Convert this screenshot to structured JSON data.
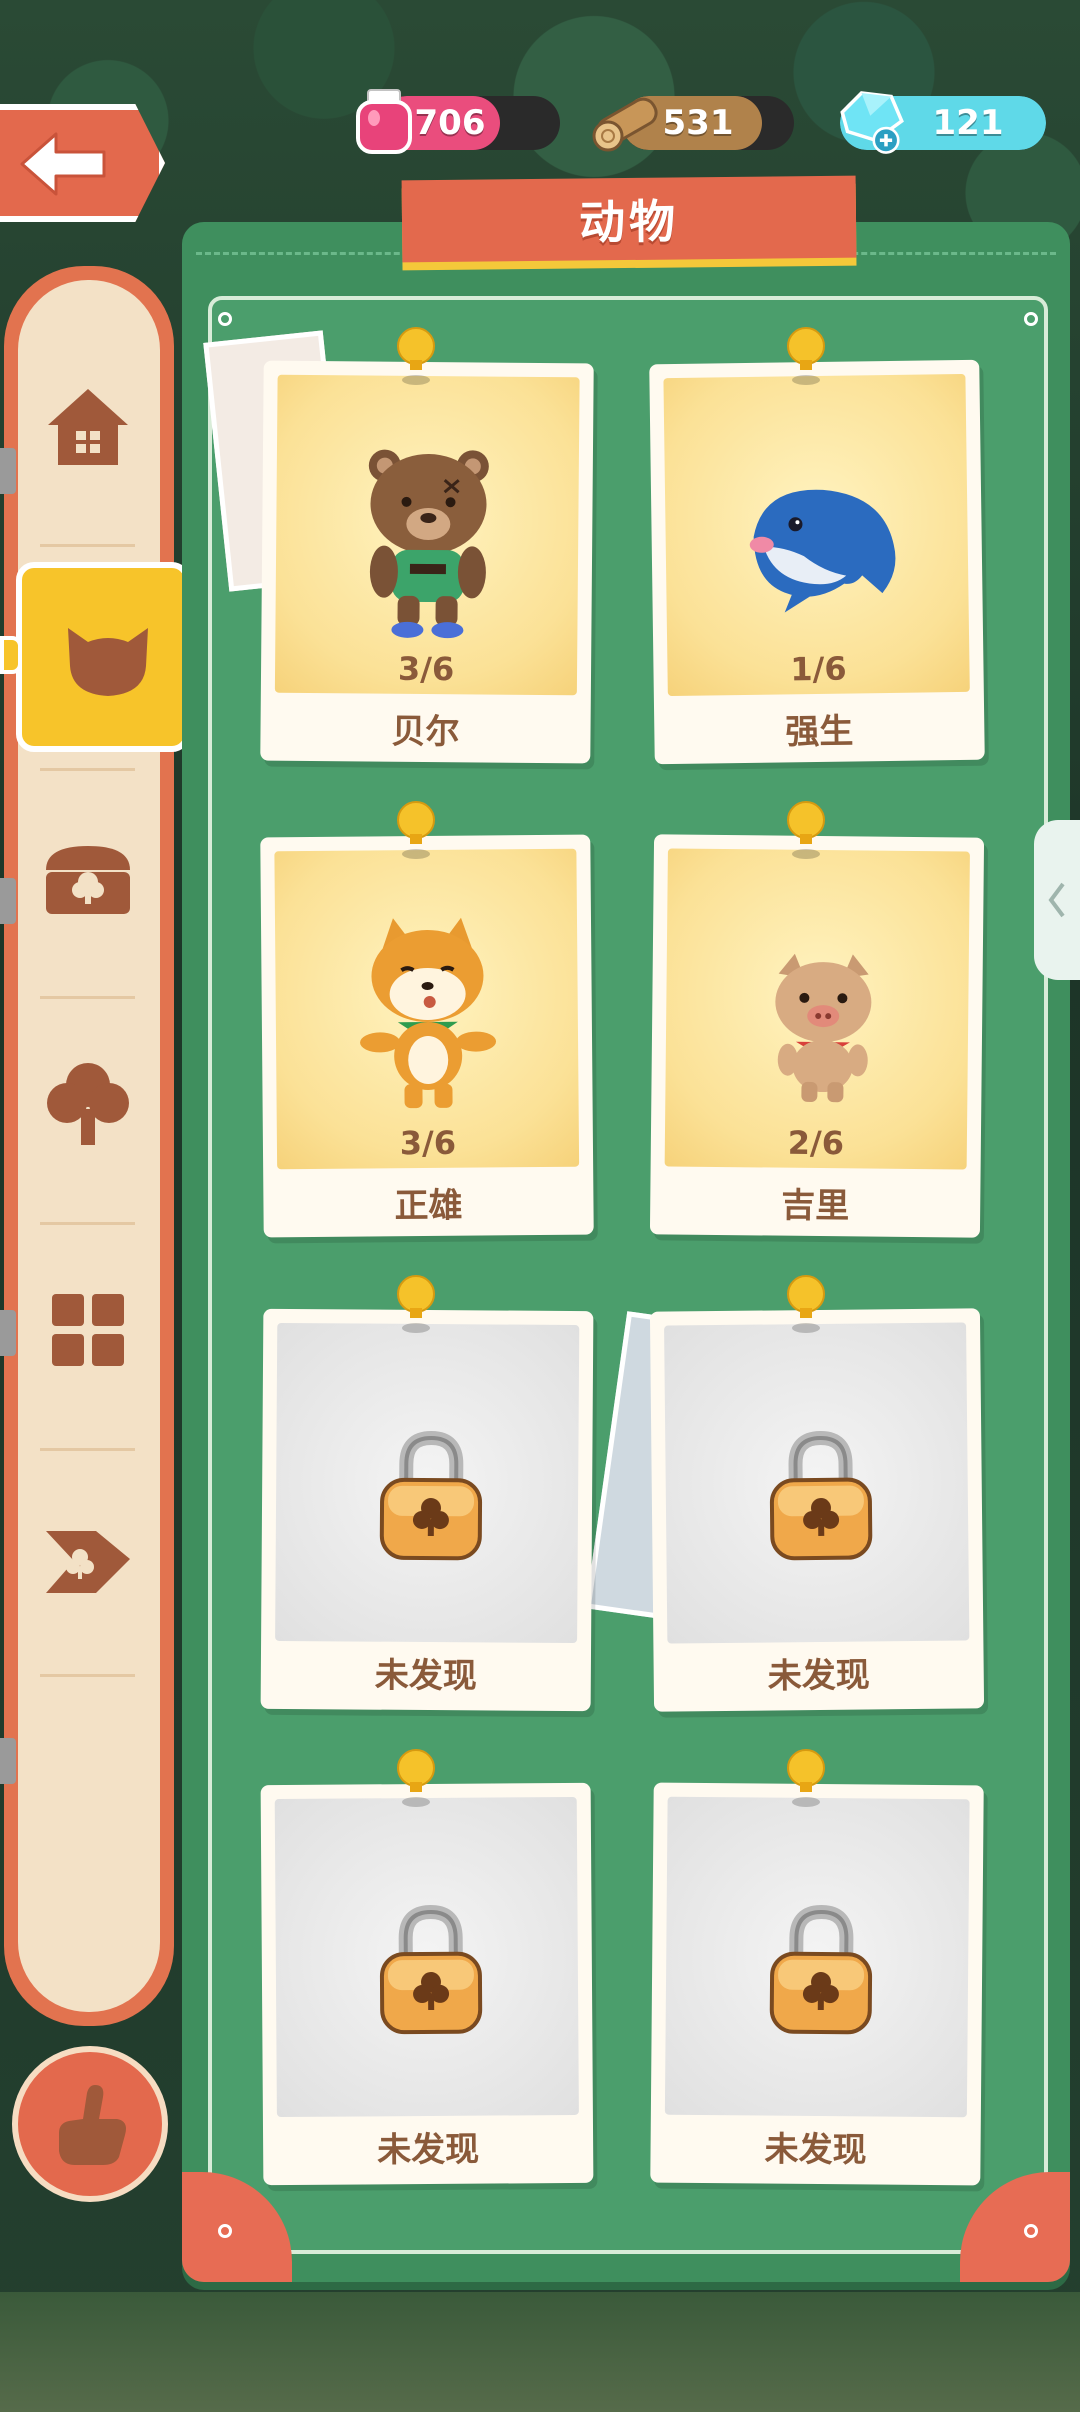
{
  "resources": {
    "ink": {
      "value": "706",
      "icon": "ink-bottle-icon",
      "color": "#ea4d7d"
    },
    "wood": {
      "value": "531",
      "icon": "wood-log-icon",
      "color": "#b0824b"
    },
    "gems": {
      "value": "121",
      "icon": "gem-icon",
      "color": "#5fd9e8"
    }
  },
  "header": {
    "title": "动物",
    "back_icon": "arrow-left-icon"
  },
  "sidebar": {
    "items": [
      {
        "name": "house",
        "icon": "house-icon",
        "active": false
      },
      {
        "name": "animal",
        "icon": "cat-head-icon",
        "active": true
      },
      {
        "name": "chest",
        "icon": "treasure-chest-icon",
        "active": false
      },
      {
        "name": "tree",
        "icon": "tree-icon",
        "active": false
      },
      {
        "name": "tiles",
        "icon": "grid-icon",
        "active": false
      },
      {
        "name": "card",
        "icon": "club-card-icon",
        "active": false
      }
    ],
    "bottom_button_icon": "pointing-hand-icon"
  },
  "cards": [
    {
      "name": "贝尔",
      "progress": "3/6",
      "locked": false,
      "icon": "bear-icon"
    },
    {
      "name": "强生",
      "progress": "1/6",
      "locked": false,
      "icon": "whale-icon"
    },
    {
      "name": "正雄",
      "progress": "3/6",
      "locked": false,
      "icon": "shiba-dog-icon"
    },
    {
      "name": "吉里",
      "progress": "2/6",
      "locked": false,
      "icon": "pig-icon"
    },
    {
      "name": "未发现",
      "locked": true,
      "icon": "padlock-icon"
    },
    {
      "name": "未发现",
      "locked": true,
      "icon": "padlock-icon"
    },
    {
      "name": "未发现",
      "locked": true,
      "icon": "padlock-icon"
    },
    {
      "name": "未发现",
      "locked": true,
      "icon": "padlock-icon"
    }
  ],
  "side_tab_icon": "chevron-left-icon",
  "colors": {
    "panel_green": "#3f8f5e",
    "accent_orange": "#e3694d",
    "active_yellow": "#f7c42a",
    "text_brown": "#8a5a3a"
  }
}
